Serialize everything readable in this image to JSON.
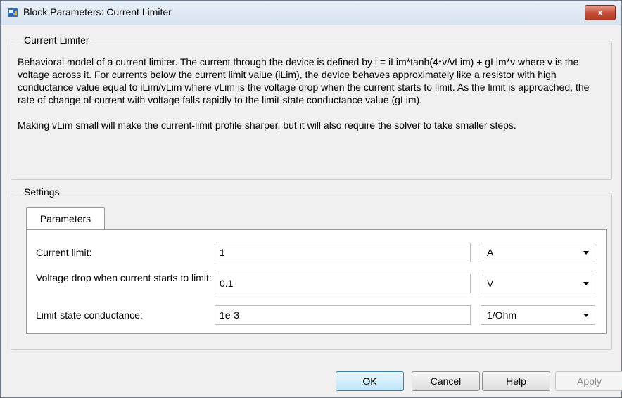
{
  "window": {
    "title": "Block Parameters: Current Limiter",
    "close_label": "x"
  },
  "block_group": {
    "legend": "Current Limiter",
    "description_1": "Behavioral model of a current limiter. The current through the device is defined by i = iLim*tanh(4*v/vLim) + gLim*v where v is the voltage across it. For currents below the current limit value (iLim), the device behaves approximately like a resistor with high conductance value equal to iLim/vLim where vLim is the voltage drop when the current starts to limit. As the limit is approached, the rate of change of current with voltage falls rapidly to the limit-state conductance value (gLim).",
    "description_2": "Making vLim small will make the current-limit profile sharper, but it will also require the solver to take smaller steps."
  },
  "settings": {
    "legend": "Settings",
    "tab_label": "Parameters",
    "rows": [
      {
        "label": "Current limit:",
        "value": "1",
        "unit": "A"
      },
      {
        "label": "Voltage drop when current starts to limit:",
        "value": "0.1",
        "unit": "V"
      },
      {
        "label": "Limit-state conductance:",
        "value": "1e-3",
        "unit": "1/Ohm"
      }
    ]
  },
  "buttons": {
    "ok": "OK",
    "cancel": "Cancel",
    "help": "Help",
    "apply": "Apply"
  }
}
